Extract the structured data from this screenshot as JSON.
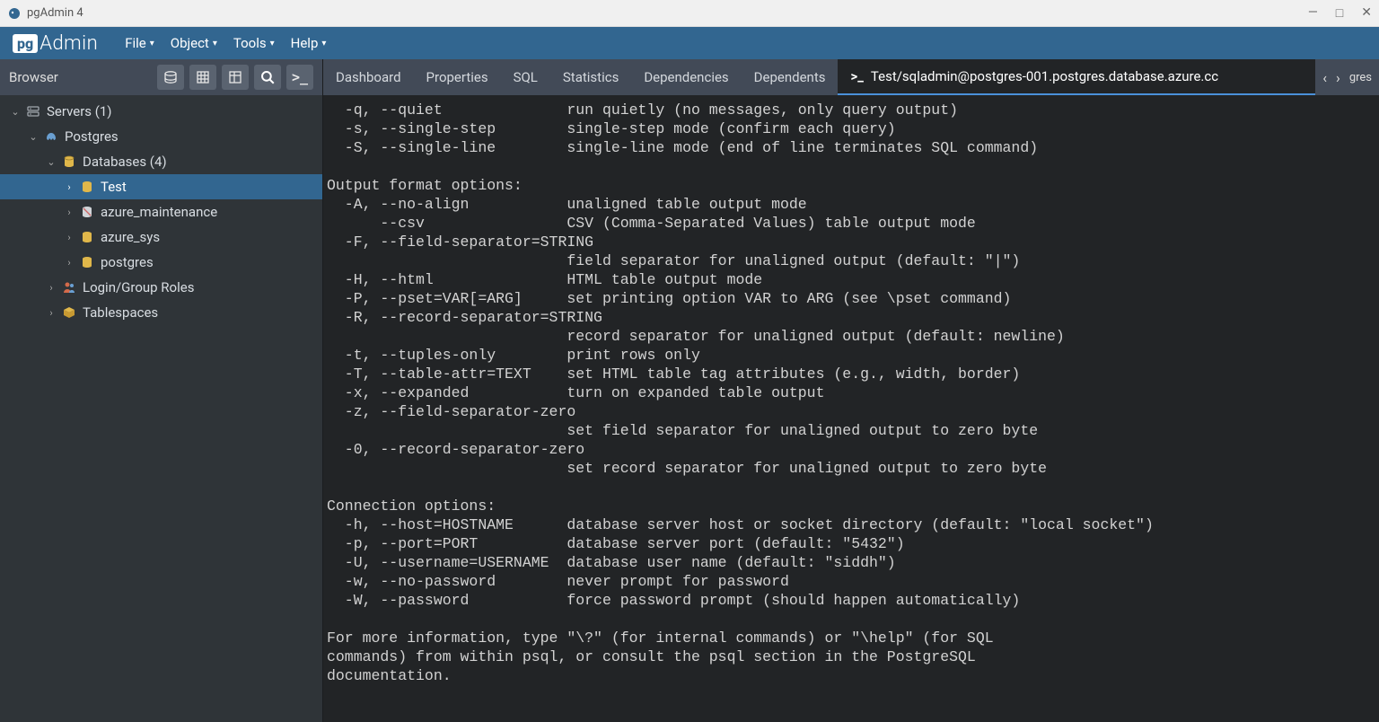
{
  "window": {
    "title": "pgAdmin 4"
  },
  "logo": {
    "box": "pg",
    "text": "Admin"
  },
  "menu": {
    "file": "File",
    "object": "Object",
    "tools": "Tools",
    "help": "Help"
  },
  "browser": {
    "label": "Browser"
  },
  "tree": {
    "servers": "Servers (1)",
    "postgres_server": "Postgres",
    "databases": "Databases (4)",
    "db_test": "Test",
    "db_azure_maintenance": "azure_maintenance",
    "db_azure_sys": "azure_sys",
    "db_postgres": "postgres",
    "login_roles": "Login/Group Roles",
    "tablespaces": "Tablespaces"
  },
  "tabs": {
    "dashboard": "Dashboard",
    "properties": "Properties",
    "sql": "SQL",
    "statistics": "Statistics",
    "dependencies": "Dependencies",
    "dependents": "Dependents",
    "terminal": "Test/sqladmin@postgres-001.postgres.database.azure.cc",
    "extra": "gres"
  },
  "terminal_text": "  -q, --quiet              run quietly (no messages, only query output)\n  -s, --single-step        single-step mode (confirm each query)\n  -S, --single-line        single-line mode (end of line terminates SQL command)\n\nOutput format options:\n  -A, --no-align           unaligned table output mode\n      --csv                CSV (Comma-Separated Values) table output mode\n  -F, --field-separator=STRING\n                           field separator for unaligned output (default: \"|\")\n  -H, --html               HTML table output mode\n  -P, --pset=VAR[=ARG]     set printing option VAR to ARG (see \\pset command)\n  -R, --record-separator=STRING\n                           record separator for unaligned output (default: newline)\n  -t, --tuples-only        print rows only\n  -T, --table-attr=TEXT    set HTML table tag attributes (e.g., width, border)\n  -x, --expanded           turn on expanded table output\n  -z, --field-separator-zero\n                           set field separator for unaligned output to zero byte\n  -0, --record-separator-zero\n                           set record separator for unaligned output to zero byte\n\nConnection options:\n  -h, --host=HOSTNAME      database server host or socket directory (default: \"local socket\")\n  -p, --port=PORT          database server port (default: \"5432\")\n  -U, --username=USERNAME  database user name (default: \"siddh\")\n  -w, --no-password        never prompt for password\n  -W, --password           force password prompt (should happen automatically)\n\nFor more information, type \"\\?\" (for internal commands) or \"\\help\" (for SQL\ncommands) from within psql, or consult the psql section in the PostgreSQL\ndocumentation."
}
